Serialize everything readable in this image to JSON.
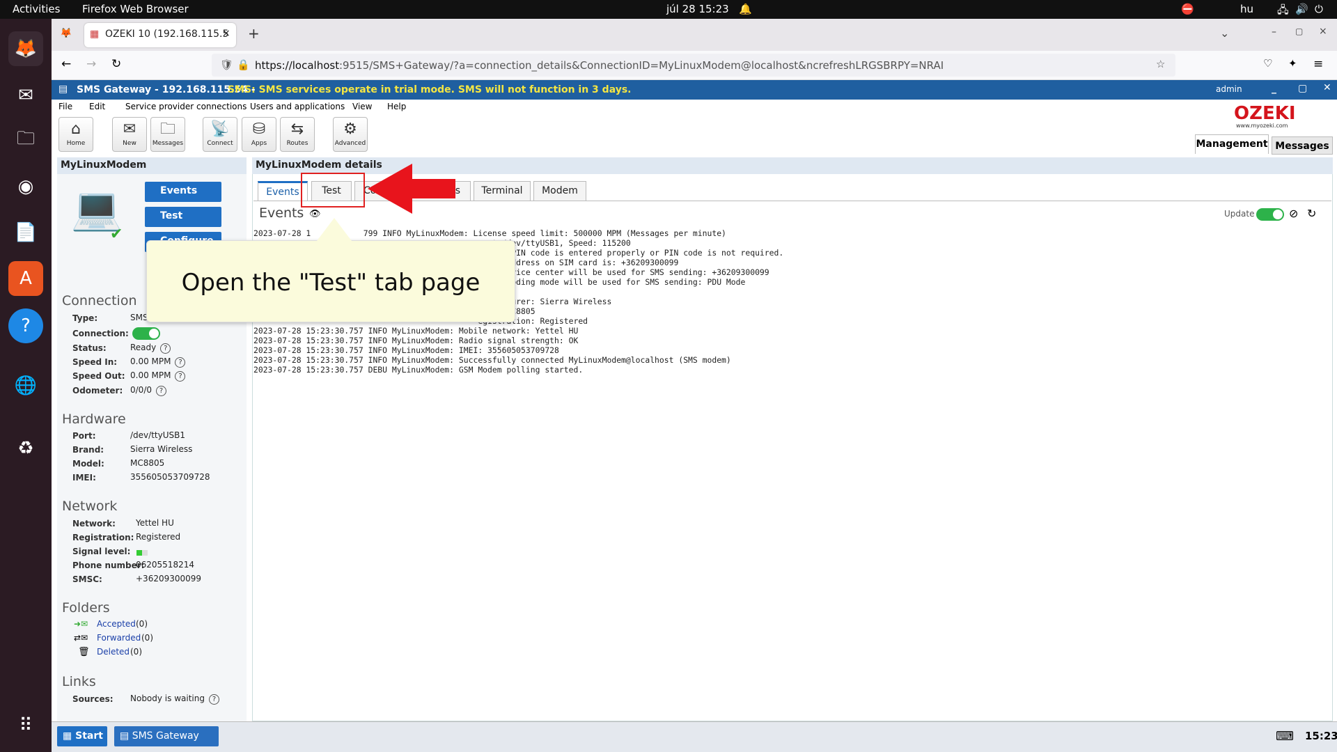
{
  "os": {
    "activities": "Activities",
    "app": "Firefox Web Browser",
    "clock": "júl 28  15:23",
    "lang": "hu"
  },
  "browser": {
    "tab_title": "OZEKI 10 (192.168.115.5",
    "url_host": "https://localhost",
    "url_rest": ":9515/SMS+Gateway/?a=connection_details&ConnectionID=MyLinuxModem@localhost&ncrefreshLRGSBRPY=NRAI"
  },
  "app": {
    "title": "SMS Gateway - 192.168.115.54 - ",
    "warning": "SMS: SMS services operate in trial mode. SMS will not function in 3 days.",
    "user": "admin",
    "logo": "OZEKI",
    "logo_sub": "www.myozeki.com"
  },
  "menu": [
    "File",
    "Edit",
    "Service provider connections",
    "Users and applications",
    "View",
    "Help"
  ],
  "toolbar": [
    "Home",
    "New",
    "Messages",
    "Connect",
    "Apps",
    "Routes",
    "Advanced"
  ],
  "top_tabs": {
    "management": "Management",
    "messages": "Messages"
  },
  "left": {
    "title": "MyLinuxModem",
    "buttons": [
      "Events",
      "Test",
      "Configure"
    ],
    "connection": {
      "heading": "Connection",
      "type_l": "Type:",
      "type_v": "SMS",
      "conn_l": "Connection:",
      "status_l": "Status:",
      "status_v": "Ready",
      "in_l": "Speed In:",
      "in_v": "0.00 MPM",
      "out_l": "Speed Out:",
      "out_v": "0.00 MPM",
      "odo_l": "Odometer:",
      "odo_v": "0/0/0"
    },
    "hardware": {
      "heading": "Hardware",
      "port_l": "Port:",
      "port_v": "/dev/ttyUSB1",
      "brand_l": "Brand:",
      "brand_v": "Sierra Wireless",
      "model_l": "Model:",
      "model_v": "MC8805",
      "imei_l": "IMEI:",
      "imei_v": "355605053709728"
    },
    "network": {
      "heading": "Network",
      "net_l": "Network:",
      "net_v": "Yettel HU",
      "reg_l": "Registration:",
      "reg_v": "Registered",
      "sig_l": "Signal level:",
      "phone_l": "Phone number:",
      "phone_v": "06205518214",
      "smsc_l": "SMSC:",
      "smsc_v": "+36209300099"
    },
    "folders": {
      "heading": "Folders",
      "accepted": "Accepted",
      "accepted_n": "(0)",
      "forwarded": "Forwarded",
      "forwarded_n": "(0)",
      "deleted": "Deleted",
      "deleted_n": "(0)"
    },
    "links": {
      "heading": "Links",
      "sources_l": "Sources:",
      "sources_v": "Nobody is waiting"
    }
  },
  "main": {
    "title": "MyLinuxModem details",
    "tabs": [
      "Events",
      "Test",
      "Co",
      "rs",
      "Terminal",
      "Modem"
    ],
    "events_heading": "Events",
    "update": "Update",
    "log": "2023-07-28 1           799 INFO MyLinuxModem: License speed limit: 500000 MPM (Messages per minute)\n                                                ort /dev/ttyUSB1, Speed: 115200\n                                               tatus: PIN code is entered properly or PIN code is not required.\n                                               enter address on SIM card is: +36209300099\n                                               ing service center will be used for SMS sending: +36209300099\n                                               ing encoding mode will be used for SMS sending: PDU Mode\n\n                                               anufacturer: Sierra Wireless\n                                               odel: MC8805\n                                               egistration: Registered\n2023-07-28 15:23:30.757 INFO MyLinuxModem: Mobile network: Yettel HU\n2023-07-28 15:23:30.757 INFO MyLinuxModem: Radio signal strength: OK\n2023-07-28 15:23:30.757 INFO MyLinuxModem: IMEI: 355605053709728\n2023-07-28 15:23:30.757 INFO MyLinuxModem: Successfully connected MyLinuxModem@localhost (SMS modem)\n2023-07-28 15:23:30.757 DEBU MyLinuxModem: GSM Modem polling started."
  },
  "bubble": "Open the \"Test\" tab page",
  "taskbar": {
    "start": "Start",
    "task": "SMS Gateway",
    "time": "15:23"
  },
  "colors": {
    "accent": "#1f5fa0",
    "arrow": "#e8141c",
    "highlight": "#e02020"
  }
}
